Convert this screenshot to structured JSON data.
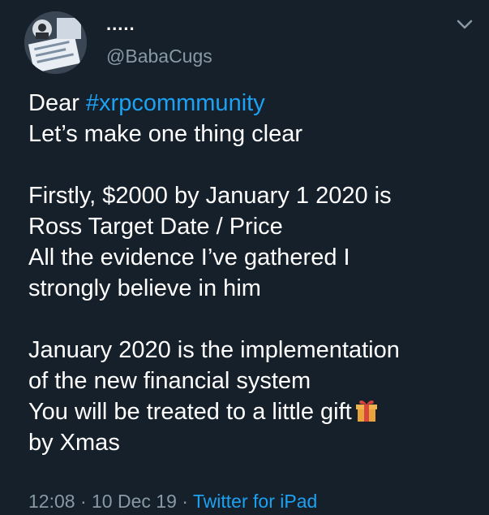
{
  "tweet": {
    "author": {
      "display_name": ".....",
      "handle": "@BabaCugs",
      "avatar_icon": "profile-photo"
    },
    "body": {
      "greeting": "Dear ",
      "hashtag": "#xrpcommmunity",
      "lines": [
        "Let’s make one thing clear",
        "Firstly, $2000 by January 1 2020 is",
        "Ross Target Date / Price",
        "All the evidence I’ve gathered I",
        "strongly believe in him",
        "January 2020 is the implementation",
        "of the new financial system",
        "You will be treated to a little gift",
        "by Xmas"
      ],
      "emoji_icon": "gift-icon"
    },
    "meta": {
      "time": "12:08",
      "separator": " · ",
      "date": "10 Dec 19",
      "source": "Twitter for iPad"
    }
  },
  "colors": {
    "background": "#15202b",
    "text": "#ffffff",
    "secondary": "#8899a6",
    "accent": "#1da1f2",
    "gift_body": "#e8a33d",
    "gift_ribbon": "#d9453a"
  }
}
